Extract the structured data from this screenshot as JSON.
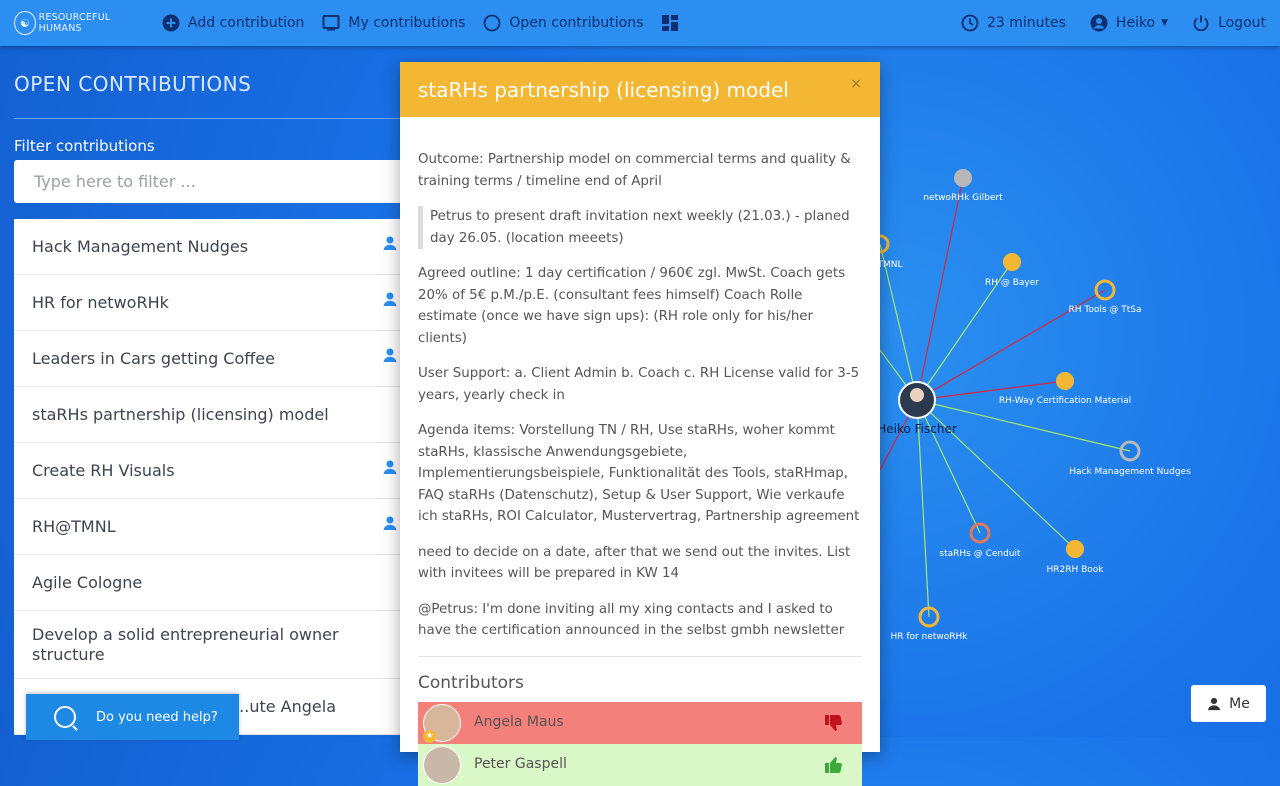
{
  "app": {
    "logo_text": "RESOURCEFUL HUMANS"
  },
  "topbar": {
    "add_contribution": "Add contribution",
    "my_contributions": "My contributions",
    "open_contributions": "Open contributions",
    "timer": "23 minutes",
    "user": "Heiko",
    "logout": "Logout"
  },
  "left": {
    "title": "OPEN CONTRIBUTIONS",
    "filter_label": "Filter contributions",
    "filter_placeholder": "Type here to filter ...",
    "items": [
      {
        "label": "Hack Management Nudges"
      },
      {
        "label": "HR for netwoRHk"
      },
      {
        "label": "Leaders in Cars getting Coffee"
      },
      {
        "label": "staRHs partnership (licensing) model"
      },
      {
        "label": "Create RH Visuals"
      },
      {
        "label": "RH@TMNL"
      },
      {
        "label": "Agile Cologne"
      },
      {
        "label": "Develop a solid entrepreneurial owner structure"
      },
      {
        "label": "...ute Angela"
      }
    ]
  },
  "help": {
    "label": "Do you need help?"
  },
  "modal": {
    "title": "staRHs partnership (licensing) model",
    "close": "×",
    "outcome": "Outcome: Partnership model on commercial terms and quality & training terms / timeline end of April",
    "quote": "Petrus to present draft invitation next weekly (21.03.) - planed day 26.05. (location meeets)",
    "p1": "Agreed outline: 1 day certification / 960€ zgl. MwSt. Coach gets 20% of 5€ p.M./p.E. (consultant fees himself) Coach Rolle estimate (once we have sign ups): (RH role only for his/her clients)",
    "p2": "User Support: a. Client Admin b. Coach c. RH License valid for 3-5 years, yearly check in",
    "p3": "Agenda items: Vorstellung TN / RH, Use staRHs, woher kommt staRHs, klassische Anwendungsgebiete, Implementierungsbeispiele, Funktionalität des Tools, staRHmap, FAQ staRHs (Datenschutz), Setup & User Support, Wie verkaufe ich staRHs, ROI Calculator, Mustervertrag, Partnership agreement",
    "p4": "need to decide on a date, after that we send out the invites. List with invitees will be prepared in KW 14",
    "p5": "@Petrus: I'm done inviting all my xing contacts and I asked to have the certification announced in the selbst gmbh newsletter",
    "contributors_title": "Contributors",
    "contributors": [
      {
        "name": "Angela Maus"
      },
      {
        "name": "Peter Gaspell"
      }
    ]
  },
  "graph": {
    "center": "Heiko Fischer",
    "nodes": [
      {
        "label": "netwoRHk Gilbert"
      },
      {
        "label": "TMNL"
      },
      {
        "label": "RH @ Bayer"
      },
      {
        "label": "RH Tools @ TtSa"
      },
      {
        "label": "RH-Way Certification Material"
      },
      {
        "label": "Hack Management Nudges"
      },
      {
        "label": "staRHs @ Cenduit"
      },
      {
        "label": "HR2RH Book"
      },
      {
        "label": "HR for netwoRHk"
      }
    ]
  },
  "me_button": "Me",
  "colors": {
    "topbar": "#2b8ef0",
    "modal_header": "#f4b733",
    "background": "#1a73e8",
    "negative": "#f3807a",
    "positive": "#d9f7c7"
  }
}
